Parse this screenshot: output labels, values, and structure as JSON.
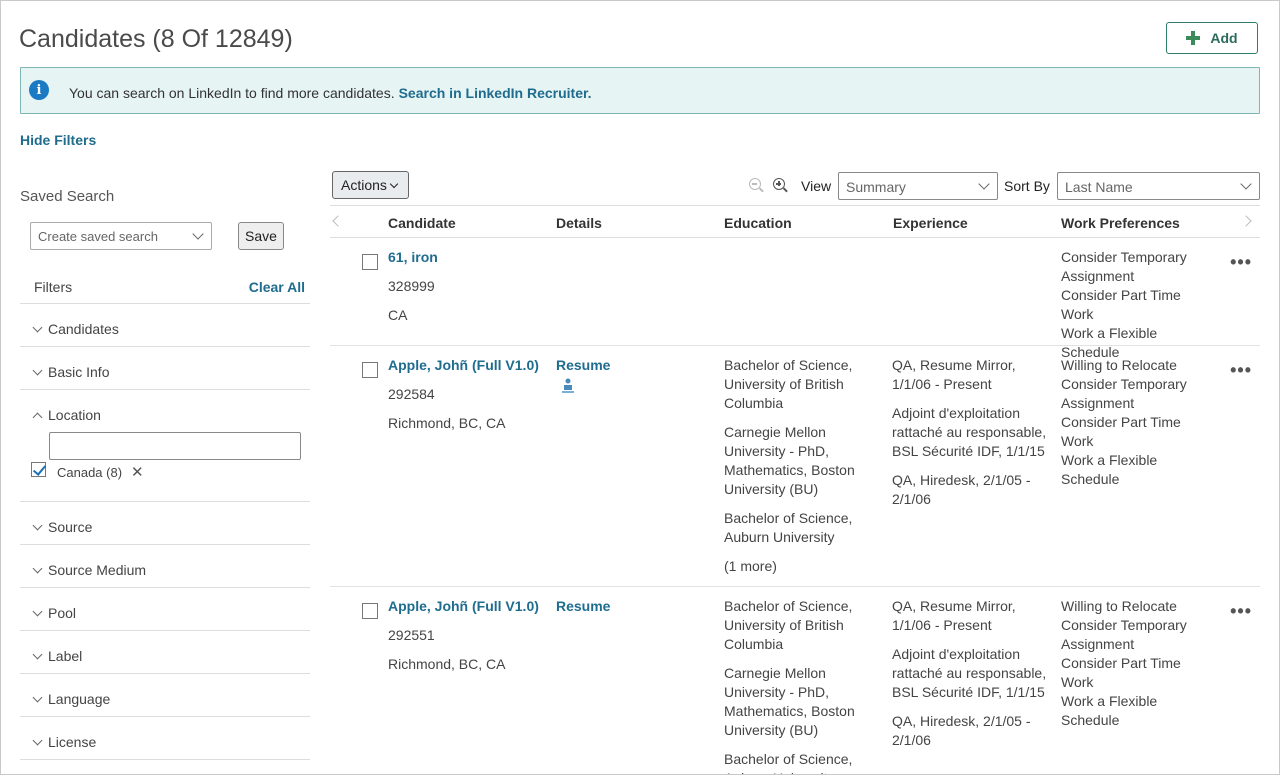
{
  "header": {
    "title": "Candidates (8 Of 12849)",
    "add_label": "Add"
  },
  "banner": {
    "text": "You can search on LinkedIn to find more candidates.",
    "link": "Search in LinkedIn Recruiter."
  },
  "hide_filters": "Hide Filters",
  "saved_search": {
    "label": "Saved Search",
    "placeholder": "Create saved search",
    "save_label": "Save"
  },
  "filters": {
    "label": "Filters",
    "clear_all": "Clear All",
    "groups": [
      {
        "label": "Candidates"
      },
      {
        "label": "Basic Info"
      },
      {
        "label": "Location"
      },
      {
        "label": "Source"
      },
      {
        "label": "Source Medium"
      },
      {
        "label": "Pool"
      },
      {
        "label": "Label"
      },
      {
        "label": "Language"
      },
      {
        "label": "License"
      }
    ],
    "location_selected": "Canada (8)"
  },
  "toolbar": {
    "actions_label": "Actions",
    "view_label": "View",
    "view_value": "Summary",
    "sort_label": "Sort By",
    "sort_value": "Last Name"
  },
  "table": {
    "columns": [
      "Candidate",
      "Details",
      "Education",
      "Experience",
      "Work Preferences"
    ],
    "rows": [
      {
        "name": "61, iron",
        "id": "328999",
        "location": "CA",
        "details": "",
        "education": [],
        "experience": [],
        "preferences": [
          "Consider Temporary Assignment",
          "Consider Part Time Work",
          "Work a Flexible Schedule"
        ]
      },
      {
        "name": "Apple, Johñ (Full V1.0)",
        "id": "292584",
        "location": "Richmond, BC, CA",
        "details": "Resume",
        "education": [
          "Bachelor of Science, University of British Columbia",
          "Carnegie Mellon University - PhD, Mathematics, Boston University (BU)",
          "Bachelor of Science, Auburn University",
          "(1 more)"
        ],
        "experience": [
          "QA, Resume Mirror, 1/1/06 - Present",
          "Adjoint d'exploitation rattaché au responsable, BSL Sécurité IDF, 1/1/15",
          "QA, Hiredesk, 2/1/05 - 2/1/06"
        ],
        "preferences": [
          "Willing to Relocate",
          "Consider Temporary Assignment",
          "Consider Part Time Work",
          "Work a Flexible Schedule"
        ]
      },
      {
        "name": "Apple, Johñ (Full V1.0)",
        "id": "292551",
        "location": "Richmond, BC, CA",
        "details": "Resume",
        "education": [
          "Bachelor of Science, University of British Columbia",
          "Carnegie Mellon University - PhD, Mathematics, Boston University (BU)",
          "Bachelor of Science, Auburn University"
        ],
        "experience": [
          "QA, Resume Mirror, 1/1/06 - Present",
          "Adjoint d'exploitation rattaché au responsable, BSL Sécurité IDF, 1/1/15",
          "QA, Hiredesk, 2/1/05 - 2/1/06"
        ],
        "preferences": [
          "Willing to Relocate",
          "Consider Temporary Assignment",
          "Consider Part Time Work",
          "Work a Flexible Schedule"
        ]
      }
    ]
  },
  "colors": {
    "link": "#1f6c8f",
    "banner_bg": "#e6f4f3",
    "banner_border": "#7fb5b2",
    "add_green": "#3a8a5b",
    "info_blue": "#1a7bc4"
  }
}
